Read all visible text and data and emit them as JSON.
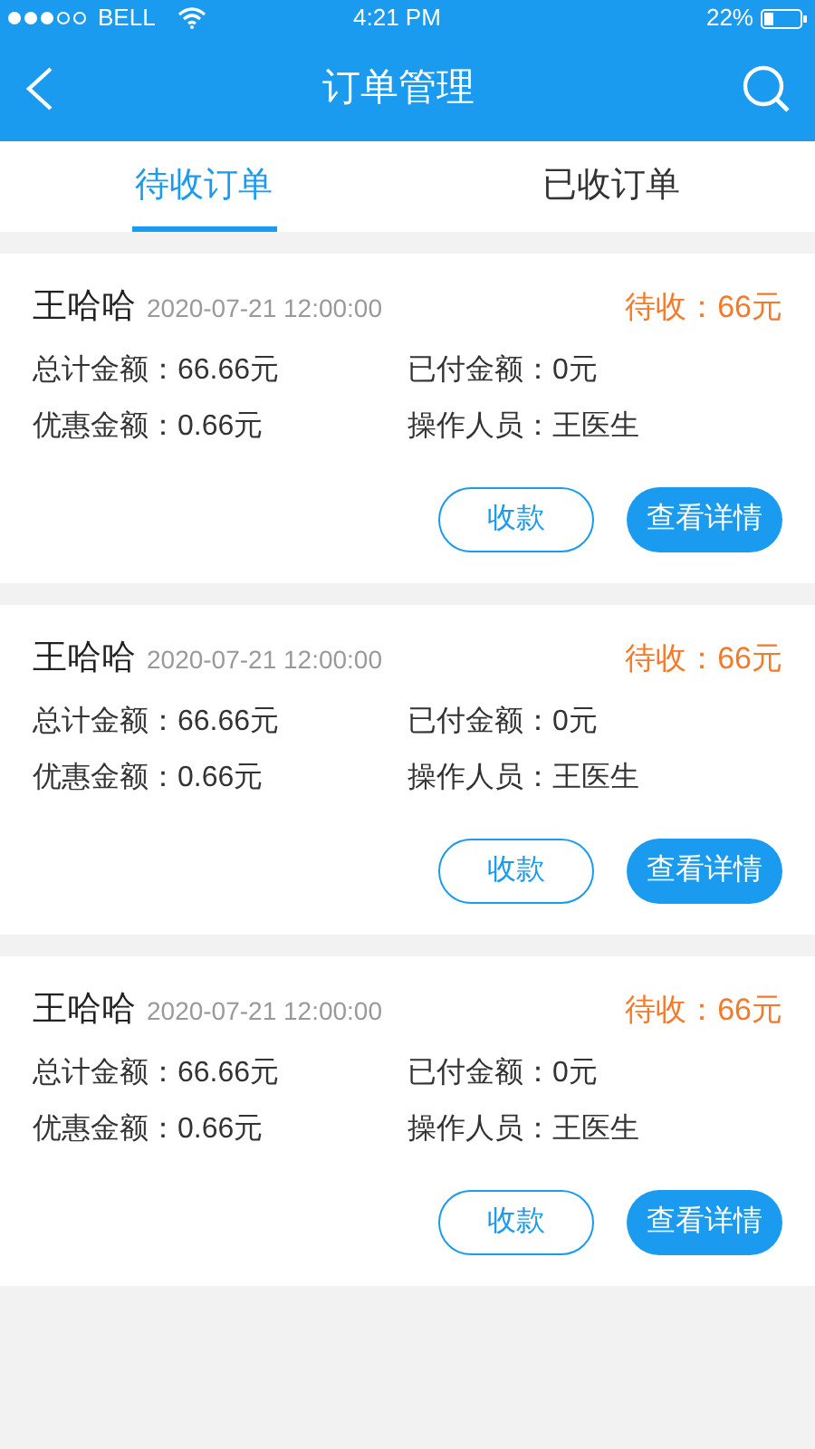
{
  "status_bar": {
    "carrier": "BELL",
    "time": "4:21 PM",
    "battery": "22%"
  },
  "header": {
    "title": "订单管理"
  },
  "tabs": [
    {
      "label": "待收订单",
      "selected": true
    },
    {
      "label": "已收订单",
      "selected": false
    }
  ],
  "orders": [
    {
      "name": "王哈哈",
      "datetime": "2020-07-21 12:00:00",
      "status": "待收：66元",
      "fields": [
        {
          "label": "总计金额：",
          "value": "66.66元"
        },
        {
          "label": "已付金额：",
          "value": "0元"
        },
        {
          "label": "优惠金额：",
          "value": "0.66元"
        },
        {
          "label": "操作人员：",
          "value": "王医生"
        }
      ],
      "buttons": [
        {
          "label": "收款",
          "kind": "outline"
        },
        {
          "label": "查看详情",
          "kind": "primary"
        }
      ]
    },
    {
      "name": "王哈哈",
      "datetime": "2020-07-21 12:00:00",
      "status": "待收：66元",
      "fields": [
        {
          "label": "总计金额：",
          "value": "66.66元"
        },
        {
          "label": "已付金额：",
          "value": "0元"
        },
        {
          "label": "优惠金额：",
          "value": "0.66元"
        },
        {
          "label": "操作人员：",
          "value": "王医生"
        }
      ],
      "buttons": [
        {
          "label": "收款",
          "kind": "outline"
        },
        {
          "label": "查看详情",
          "kind": "primary"
        }
      ]
    },
    {
      "name": "王哈哈",
      "datetime": "2020-07-21 12:00:00",
      "status": "待收：66元",
      "fields": [
        {
          "label": "总计金额：",
          "value": "66.66元"
        },
        {
          "label": "已付金额：",
          "value": "0元"
        },
        {
          "label": "优惠金额：",
          "value": "0.66元"
        },
        {
          "label": "操作人员：",
          "value": "王医生"
        }
      ],
      "buttons": [
        {
          "label": "收款",
          "kind": "outline"
        },
        {
          "label": "查看详情",
          "kind": "primary"
        }
      ]
    }
  ]
}
